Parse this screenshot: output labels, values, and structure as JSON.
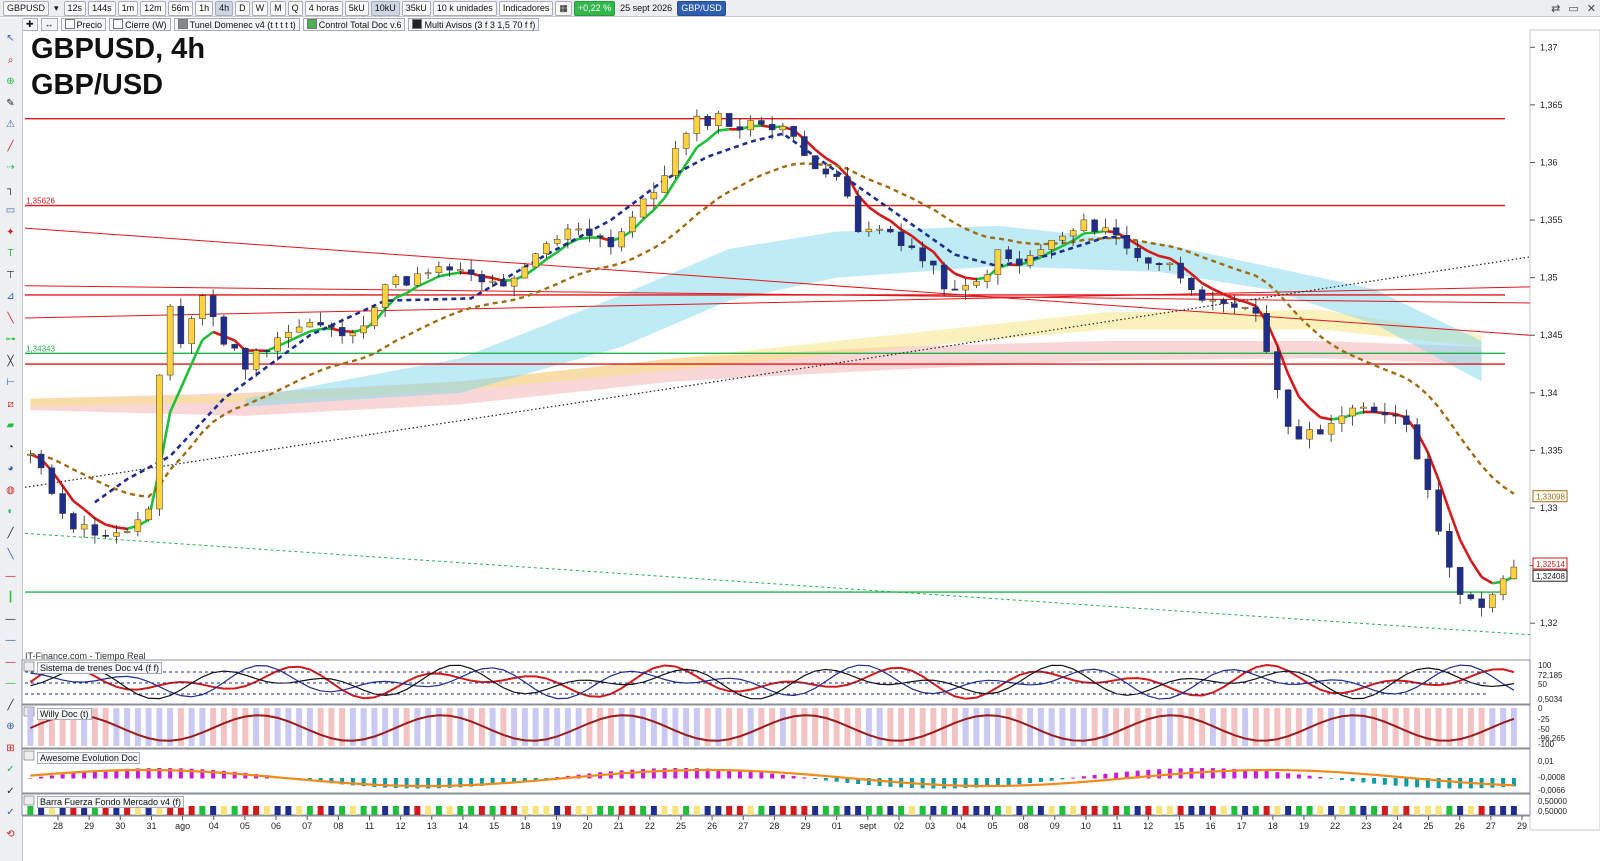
{
  "toolbar": {
    "symbol": "GBPUSD",
    "periods": [
      "12s",
      "144s",
      "1m",
      "12m",
      "56m",
      "1h",
      "4h",
      "D",
      "W",
      "M",
      "Q"
    ],
    "selected_period": "4h",
    "timeframe": "4 horas",
    "volumes": [
      "5kU",
      "10kU",
      "35kU"
    ],
    "selected_volume": "10kU",
    "units": "10 k unidades",
    "indicators": "Indicadores",
    "change": "+0,22 %",
    "date": "25 sept 2026",
    "pair_badge": "GBP/USD"
  },
  "legend": [
    "Precio",
    "Cierre (W)",
    "Tunel Domenec v4 (t t t t t)",
    "Control Total Doc v.6",
    "Multi Avisos (3 f 3 1,5 70 f f)"
  ],
  "chart_title": "GBPUSD, 4h",
  "chart_subtitle": "GBP/USD",
  "source": "IT-Finance.com - Tiempo Real",
  "chart_data": {
    "type": "candlestick",
    "y_axis": {
      "ticks": [
        "1,37",
        "1,365",
        "1,36",
        "1,355",
        "1,35",
        "1,345",
        "1,34",
        "1,335",
        "1,33",
        "1,325",
        "1,32"
      ],
      "ylim": [
        1.3175,
        1.3715
      ]
    },
    "x_axis": {
      "ticks": [
        "28",
        "29",
        "30",
        "31",
        "ago",
        "04",
        "05",
        "06",
        "07",
        "08",
        "11",
        "12",
        "13",
        "14",
        "15",
        "18",
        "19",
        "20",
        "21",
        "22",
        "25",
        "26",
        "27",
        "28",
        "29",
        "01",
        "sept",
        "02",
        "03",
        "04",
        "05",
        "08",
        "09",
        "10",
        "11",
        "12",
        "15",
        "16",
        "17",
        "18",
        "19",
        "22",
        "23",
        "24",
        "25",
        "26",
        "27",
        "29"
      ]
    },
    "price_path": [
      [
        0,
        1.3345
      ],
      [
        4,
        1.3285
      ],
      [
        8,
        1.3275
      ],
      [
        11,
        1.3295
      ],
      [
        12,
        1.341
      ],
      [
        13,
        1.3475
      ],
      [
        14,
        1.3445
      ],
      [
        16,
        1.3485
      ],
      [
        18,
        1.3445
      ],
      [
        20,
        1.3425
      ],
      [
        23,
        1.345
      ],
      [
        26,
        1.346
      ],
      [
        30,
        1.3448
      ],
      [
        33,
        1.3495
      ],
      [
        36,
        1.35
      ],
      [
        39,
        1.3508
      ],
      [
        42,
        1.3495
      ],
      [
        45,
        1.3495
      ],
      [
        48,
        1.3528
      ],
      [
        51,
        1.3545
      ],
      [
        54,
        1.353
      ],
      [
        58,
        1.3575
      ],
      [
        60,
        1.361
      ],
      [
        62,
        1.3635
      ],
      [
        64,
        1.364
      ],
      [
        66,
        1.363
      ],
      [
        68,
        1.3635
      ],
      [
        70,
        1.3632
      ],
      [
        72,
        1.3605
      ],
      [
        75,
        1.359
      ],
      [
        77,
        1.354
      ],
      [
        80,
        1.354
      ],
      [
        82,
        1.3525
      ],
      [
        84,
        1.3505
      ],
      [
        86,
        1.3485
      ],
      [
        88,
        1.3495
      ],
      [
        90,
        1.352
      ],
      [
        92,
        1.351
      ],
      [
        94,
        1.3525
      ],
      [
        96,
        1.3535
      ],
      [
        98,
        1.3545
      ],
      [
        100,
        1.3545
      ],
      [
        102,
        1.3525
      ],
      [
        104,
        1.3515
      ],
      [
        106,
        1.351
      ],
      [
        108,
        1.3495
      ],
      [
        110,
        1.3475
      ],
      [
        112,
        1.347
      ],
      [
        114,
        1.347
      ],
      [
        116,
        1.3405
      ],
      [
        117,
        1.3365
      ],
      [
        119,
        1.3365
      ],
      [
        121,
        1.3375
      ],
      [
        124,
        1.3385
      ],
      [
        126,
        1.3385
      ],
      [
        128,
        1.3375
      ],
      [
        130,
        1.332
      ],
      [
        131,
        1.3275
      ],
      [
        133,
        1.323
      ],
      [
        135,
        1.321
      ],
      [
        137,
        1.3235
      ],
      [
        138,
        1.325
      ]
    ],
    "series": [
      {
        "name": "Tunel Domenec v4 (t t t t t)",
        "color": "#1f2d8c",
        "values": [
          [
            6,
            1.3305
          ],
          [
            9,
            1.3325
          ],
          [
            13,
            1.3345
          ],
          [
            18,
            1.3395
          ],
          [
            26,
            1.345
          ],
          [
            33,
            1.348
          ],
          [
            41,
            1.3482
          ],
          [
            48,
            1.352
          ],
          [
            54,
            1.355
          ],
          [
            59,
            1.3585
          ],
          [
            63,
            1.3605
          ],
          [
            67,
            1.3618
          ],
          [
            70,
            1.3625
          ],
          [
            86,
            1.352
          ],
          [
            90,
            1.351
          ],
          [
            95,
            1.352
          ],
          [
            100,
            1.3535
          ],
          [
            102,
            1.3535
          ]
        ]
      }
    ],
    "reference_levels": [
      {
        "value": 1.3638,
        "color": "#e0161b"
      },
      {
        "value": 1.35626,
        "color": "#e0161b",
        "label": "1,35626"
      },
      {
        "value": 1.3485,
        "color": "#e0161b"
      },
      {
        "value": 1.34343,
        "color": "#23b24a",
        "label": "1,34343"
      },
      {
        "value": 1.3425,
        "color": "#e0161b"
      },
      {
        "value": 1.3227,
        "color": "#23b24a"
      }
    ],
    "price_labels": [
      "1,33098",
      "1,32514",
      "1,32408"
    ],
    "panels": [
      {
        "title": "Sistema de trenes Doc v4 (f f)",
        "axis": [
          "100",
          "72,185",
          "50",
          "0,5034"
        ]
      },
      {
        "title": "Willy Doc (t)",
        "axis": [
          "0",
          "-25",
          "-50",
          "-96,265",
          "-100"
        ]
      },
      {
        "title": "Awesome Evolution Doc",
        "axis": [
          "0,01",
          "-0,0008",
          "-0,0066"
        ]
      },
      {
        "title": "Barra Fuerza Fondo Mercado v4 (f)",
        "axis": [
          "0,50000",
          "0,50000"
        ]
      }
    ]
  },
  "colors": {
    "up": "#ffd23e",
    "down": "#1f2d8c",
    "ema_up": "#1fbf3a",
    "ema_down": "#d21a1a",
    "dash_blue": "#1f2d8c",
    "dash_brown": "#a06c12",
    "red": "#e0161b",
    "green": "#23b24a"
  }
}
